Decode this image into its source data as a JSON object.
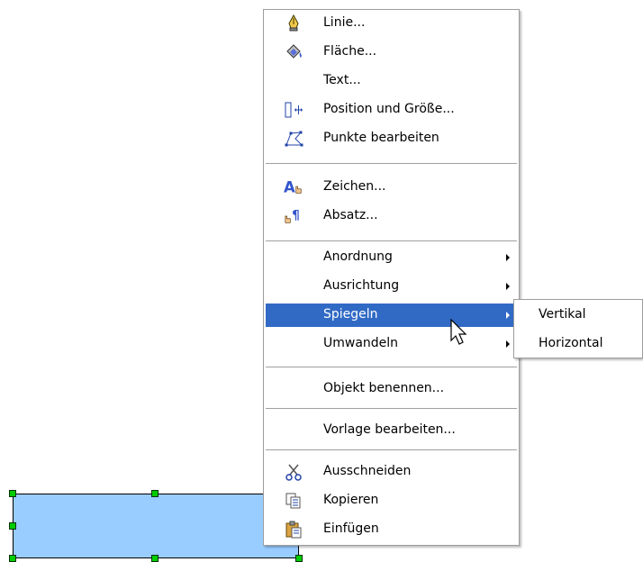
{
  "menu": {
    "items": [
      {
        "label": "Linie...",
        "icon": "pen-icon"
      },
      {
        "label": "Fläche...",
        "icon": "paint-bucket-icon"
      },
      {
        "label": "Text..."
      },
      {
        "label": "Position und Größe...",
        "icon": "position-size-icon"
      },
      {
        "label": "Punkte bearbeiten",
        "icon": "edit-points-icon"
      },
      {
        "label": "Zeichen...",
        "icon": "character-icon"
      },
      {
        "label": "Absatz...",
        "icon": "paragraph-icon"
      },
      {
        "label": "Anordnung",
        "submenu": true
      },
      {
        "label": "Ausrichtung",
        "submenu": true
      },
      {
        "label": "Spiegeln",
        "submenu": true,
        "highlighted": true
      },
      {
        "label": "Umwandeln",
        "submenu": true
      },
      {
        "label": "Objekt benennen..."
      },
      {
        "label": "Vorlage bearbeiten..."
      },
      {
        "label": "Ausschneiden",
        "icon": "scissors-icon"
      },
      {
        "label": "Kopieren",
        "icon": "copy-icon"
      },
      {
        "label": "Einfügen",
        "icon": "clipboard-icon"
      }
    ]
  },
  "submenu": {
    "items": [
      {
        "label": "Vertikal"
      },
      {
        "label": "Horizontal"
      }
    ]
  },
  "colors": {
    "highlight": "#316ac5",
    "shape_fill": "#99ccff",
    "handle": "#00cc00"
  }
}
